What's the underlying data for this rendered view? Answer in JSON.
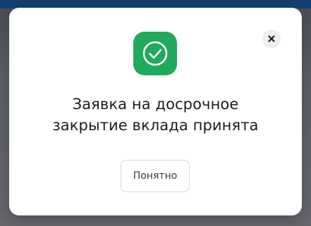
{
  "dialog": {
    "message_line1": "Заявка на досрочное",
    "message_line2": "закрытие вклада принята",
    "confirm_label": "Понятно",
    "close_icon": "close-icon",
    "status_icon": "check-circle-icon"
  },
  "colors": {
    "success": "#1faa5c",
    "header": "#123f73",
    "overlay": "#5e6169"
  }
}
